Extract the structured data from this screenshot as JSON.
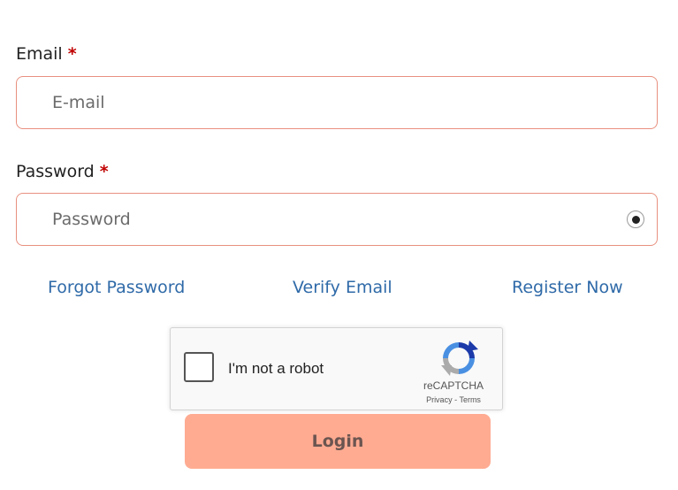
{
  "form": {
    "email": {
      "label": "Email",
      "required_mark": "*",
      "placeholder": "E-mail",
      "value": ""
    },
    "password": {
      "label": "Password",
      "required_mark": "*",
      "placeholder": "Password",
      "value": "",
      "toggle_icon": "eye-icon"
    }
  },
  "links": {
    "forgot_password": "Forgot Password",
    "verify_email": "Verify Email",
    "register_now": "Register Now"
  },
  "recaptcha": {
    "checkbox_label": "I'm not a robot",
    "checked": false,
    "brand": "reCAPTCHA",
    "privacy": "Privacy",
    "separator": "-",
    "terms": "Terms"
  },
  "login_button": {
    "label": "Login"
  },
  "colors": {
    "input_border": "#e8907f",
    "required_star": "#c00000",
    "link": "#2f6aa8",
    "login_button_bg": "#ffab92"
  }
}
